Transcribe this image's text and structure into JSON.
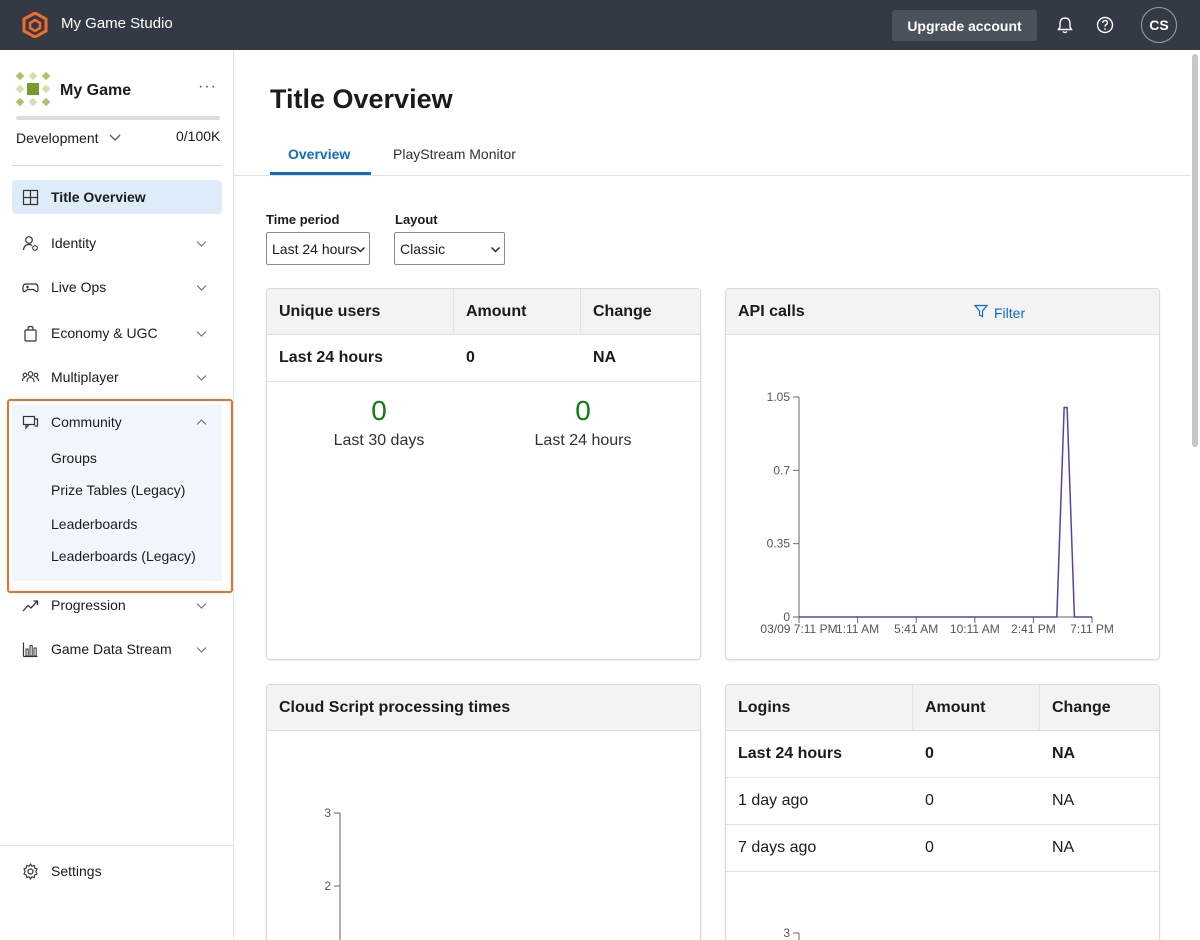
{
  "topbar": {
    "studio_name": "My Game Studio",
    "upgrade_label": "Upgrade account",
    "avatar_initials": "CS",
    "bg_color": "#333a45",
    "logo_color": "#f46b2a"
  },
  "sidebar": {
    "game_name": "My Game",
    "game_menu": "···",
    "environment": "Development",
    "usage": "0/100K",
    "items": [
      {
        "label": "Title Overview",
        "icon": "grid-icon",
        "active": true
      },
      {
        "label": "Identity",
        "icon": "identity-icon"
      },
      {
        "label": "Live Ops",
        "icon": "gamepad-icon"
      },
      {
        "label": "Economy & UGC",
        "icon": "bag-icon"
      },
      {
        "label": "Multiplayer",
        "icon": "people-icon"
      },
      {
        "label": "Community",
        "icon": "chat-icon",
        "expanded": true
      },
      {
        "label": "Progression",
        "icon": "trend-icon"
      },
      {
        "label": "Game Data Stream",
        "icon": "bar-chart-icon"
      }
    ],
    "community_subitems": [
      "Groups",
      "Prize Tables (Legacy)",
      "Leaderboards",
      "Leaderboards (Legacy)"
    ],
    "settings_label": "Settings",
    "highlight_color": "#e8702a"
  },
  "main": {
    "title": "Title Overview",
    "tabs": [
      {
        "label": "Overview",
        "selected": true
      },
      {
        "label": "PlayStream Monitor"
      }
    ],
    "time_period": {
      "label": "Time period",
      "value": "Last 24 hours"
    },
    "layout": {
      "label": "Layout",
      "value": "Classic"
    },
    "unique_users": {
      "title": "Unique users",
      "columns": [
        "Amount",
        "Change"
      ],
      "row": {
        "period": "Last 24 hours",
        "amount": "0",
        "change": "NA"
      },
      "summary": [
        {
          "value": "0",
          "caption": "Last 30 days"
        },
        {
          "value": "0",
          "caption": "Last 24 hours"
        }
      ]
    },
    "api_calls": {
      "title": "API calls",
      "filter_label": "Filter"
    },
    "cloud_script": {
      "title": "Cloud Script processing times",
      "y_ticks": [
        "3",
        "2"
      ]
    },
    "logins": {
      "title": "Logins",
      "columns": [
        "Amount",
        "Change"
      ],
      "rows": [
        {
          "period": "Last 24 hours",
          "amount": "0",
          "change": "NA",
          "bold": true
        },
        {
          "period": "1 day ago",
          "amount": "0",
          "change": "NA"
        },
        {
          "period": "7 days ago",
          "amount": "0",
          "change": "NA"
        }
      ],
      "y_ticks": [
        "3"
      ]
    }
  },
  "chart_data": {
    "type": "line",
    "title": "API calls",
    "x_ticks": [
      "03/09 7:11 PM",
      "1:11 AM",
      "5:41 AM",
      "10:11 AM",
      "2:41 PM",
      "7:11 PM"
    ],
    "y_ticks": [
      "1.05",
      "0.7",
      "0.35",
      "0"
    ],
    "ylim": [
      0,
      1.05
    ],
    "x_fraction": [
      0,
      0.88,
      0.905,
      0.915,
      0.94,
      1.0
    ],
    "series": [
      {
        "values": [
          0,
          0,
          1.0,
          1.0,
          0,
          0
        ],
        "color": "#5b3fa7"
      }
    ],
    "grid": false
  }
}
